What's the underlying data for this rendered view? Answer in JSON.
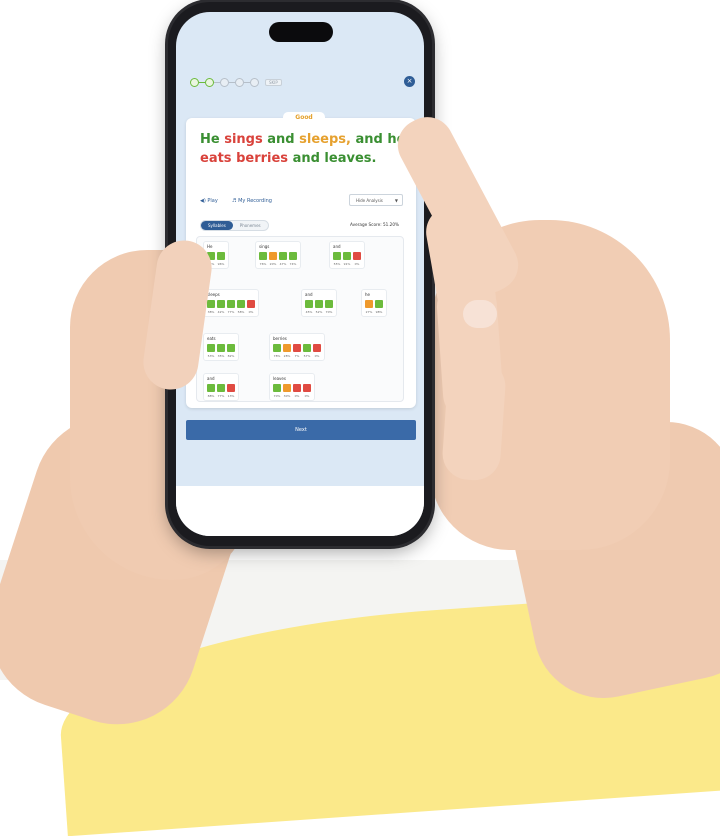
{
  "app": {
    "progress_label": "SKIP",
    "close_icon": "×",
    "feedback_label": "Good",
    "sentence": [
      {
        "text": "He",
        "color": "green"
      },
      {
        "text": "sings",
        "color": "red"
      },
      {
        "text": "and",
        "color": "green"
      },
      {
        "text": "sleeps,",
        "color": "orange"
      },
      {
        "text": "and he",
        "color": "green"
      },
      {
        "text": "eats",
        "color": "red"
      },
      {
        "text": "berries",
        "color": "red"
      },
      {
        "text": "and leaves.",
        "color": "green"
      }
    ],
    "play_label": "Play",
    "recording_label": "My Recording",
    "analysis_select": "Hide Analysis",
    "tabs": [
      "Syllables",
      "Phonemes"
    ],
    "average_score": "Average Score: 51.20%",
    "next_label": "Next"
  },
  "words": [
    {
      "word": "He",
      "cells": [
        {
          "c": "green",
          "p": "74%"
        },
        {
          "c": "green",
          "p": "96%"
        }
      ]
    },
    {
      "word": "sings",
      "cells": [
        {
          "c": "green",
          "p": "76%"
        },
        {
          "c": "orange",
          "p": "20%"
        },
        {
          "c": "green",
          "p": "47%"
        },
        {
          "c": "green",
          "p": "74%"
        }
      ]
    },
    {
      "word": "and",
      "cells": [
        {
          "c": "green",
          "p": "55%"
        },
        {
          "c": "green",
          "p": "91%"
        },
        {
          "c": "red",
          "p": "0%"
        }
      ]
    },
    {
      "word": "sleeps",
      "cells": [
        {
          "c": "green",
          "p": "38%"
        },
        {
          "c": "green",
          "p": "42%"
        },
        {
          "c": "green",
          "p": "77%"
        },
        {
          "c": "green",
          "p": "58%"
        },
        {
          "c": "red",
          "p": "0%"
        }
      ]
    },
    {
      "word": "and",
      "cells": [
        {
          "c": "green",
          "p": "45%"
        },
        {
          "c": "green",
          "p": "52%"
        },
        {
          "c": "green",
          "p": "70%"
        }
      ]
    },
    {
      "word": "he",
      "cells": [
        {
          "c": "orange",
          "p": "27%"
        },
        {
          "c": "green",
          "p": "98%"
        }
      ]
    },
    {
      "word": "eats",
      "cells": [
        {
          "c": "green",
          "p": "53%"
        },
        {
          "c": "green",
          "p": "35%"
        },
        {
          "c": "green",
          "p": "82%"
        }
      ]
    },
    {
      "word": "berries",
      "cells": [
        {
          "c": "green",
          "p": "78%"
        },
        {
          "c": "orange",
          "p": "28%"
        },
        {
          "c": "red",
          "p": "7%"
        },
        {
          "c": "green",
          "p": "57%"
        },
        {
          "c": "red",
          "p": "0%"
        }
      ]
    },
    {
      "word": "and",
      "cells": [
        {
          "c": "green",
          "p": "88%"
        },
        {
          "c": "green",
          "p": "77%"
        },
        {
          "c": "red",
          "p": "13%"
        }
      ]
    },
    {
      "word": "leaves",
      "cells": [
        {
          "c": "green",
          "p": "70%"
        },
        {
          "c": "orange",
          "p": "30%"
        },
        {
          "c": "red",
          "p": "0%"
        },
        {
          "c": "red",
          "p": "0%"
        }
      ]
    }
  ],
  "colors": {
    "accent": "#2f5d96",
    "good": "#6cbb3c",
    "fair": "#ef9a2d",
    "poor": "#e04b42"
  }
}
